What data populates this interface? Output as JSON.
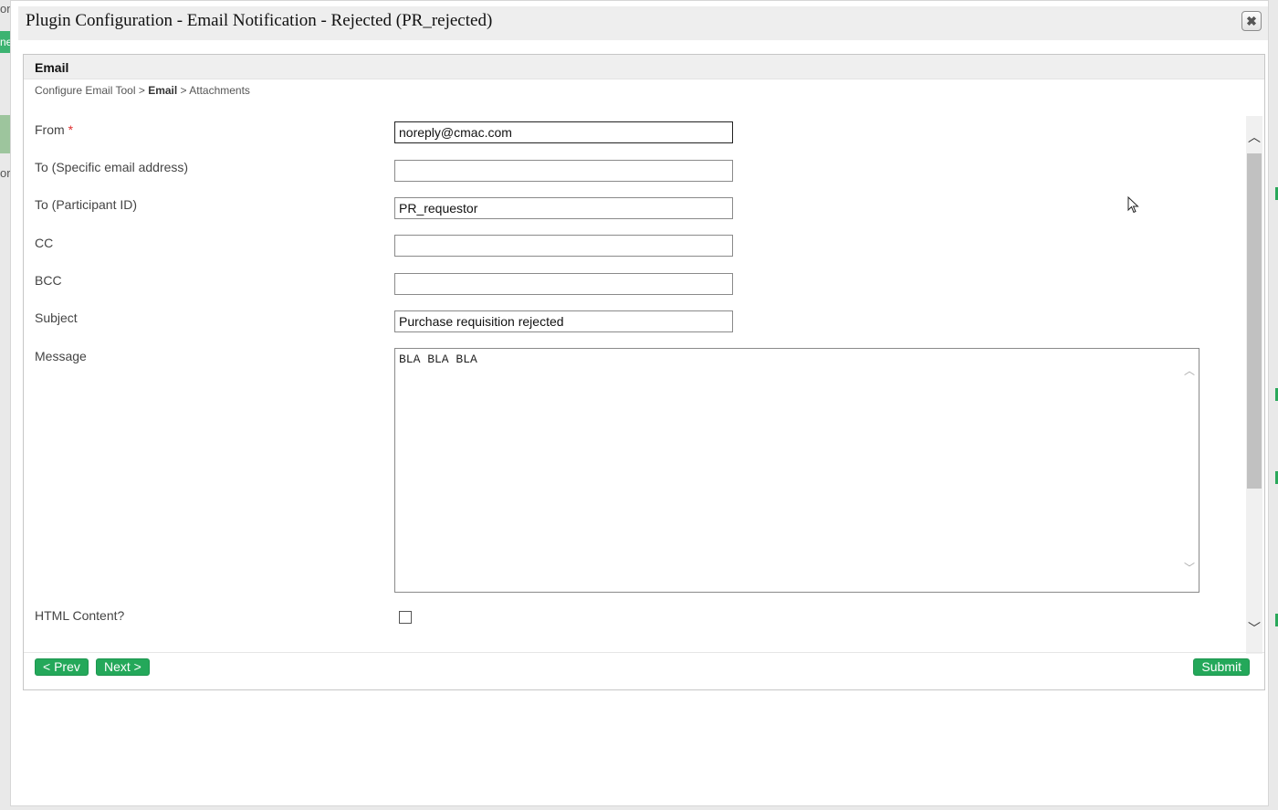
{
  "background": {
    "frag1": "on",
    "frag2": "ne",
    "frag3": "or"
  },
  "dialog": {
    "title": "Plugin Configuration - Email Notification - Rejected (PR_rejected)",
    "close_icon": "close-icon"
  },
  "panel": {
    "title": "Email",
    "breadcrumb": {
      "step1": "Configure Email Tool",
      "sep1": " > ",
      "step2": "Email",
      "sep2": " > ",
      "step3": "Attachments"
    }
  },
  "form": {
    "from": {
      "label": "From",
      "required": "*",
      "value": "noreply@cmac.com"
    },
    "to_email": {
      "label": "To (Specific email address)",
      "value": ""
    },
    "to_participant": {
      "label": "To (Participant ID)",
      "value": "PR_requestor"
    },
    "cc": {
      "label": "CC",
      "value": ""
    },
    "bcc": {
      "label": "BCC",
      "value": ""
    },
    "subject": {
      "label": "Subject",
      "value": "Purchase requisition rejected"
    },
    "message": {
      "label": "Message",
      "value": "BLA BLA BLA"
    },
    "html_content": {
      "label": "HTML Content?",
      "checked": false
    }
  },
  "footer": {
    "prev_label": "< Prev",
    "next_label": "Next >",
    "submit_label": "Submit"
  },
  "colors": {
    "button_green": "#24a85a",
    "required_red": "#e03030"
  }
}
